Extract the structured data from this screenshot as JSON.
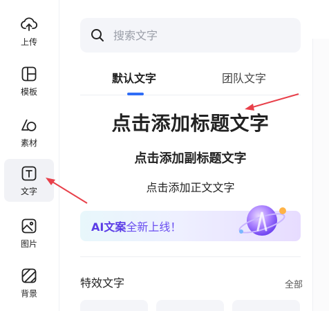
{
  "rail": {
    "items": [
      {
        "key": "upload",
        "label": "上传",
        "icon": "cloud-upload-icon"
      },
      {
        "key": "template",
        "label": "模板",
        "icon": "template-grid-icon"
      },
      {
        "key": "material",
        "label": "素材",
        "icon": "shapes-icon"
      },
      {
        "key": "text",
        "label": "文字",
        "icon": "text-t-icon",
        "active": true
      },
      {
        "key": "image",
        "label": "图片",
        "icon": "image-icon"
      },
      {
        "key": "background",
        "label": "背景",
        "icon": "background-stripes-icon"
      }
    ]
  },
  "search": {
    "placeholder": "搜索文字"
  },
  "tabs": [
    {
      "label": "默认文字",
      "active": true
    },
    {
      "label": "团队文字",
      "active": false
    }
  ],
  "text_presets": {
    "title": "点击添加标题文字",
    "subtitle": "点击添加副标题文字",
    "body": "点击添加正文文字"
  },
  "banner": {
    "strong": "AI文案",
    "rest": "全新上线！"
  },
  "section": {
    "title": "特效文字",
    "all_label": "全部"
  },
  "colors": {
    "accent": "#2f6df6",
    "annotation": "#e8404a",
    "banner_text": "#6a4ef0"
  }
}
